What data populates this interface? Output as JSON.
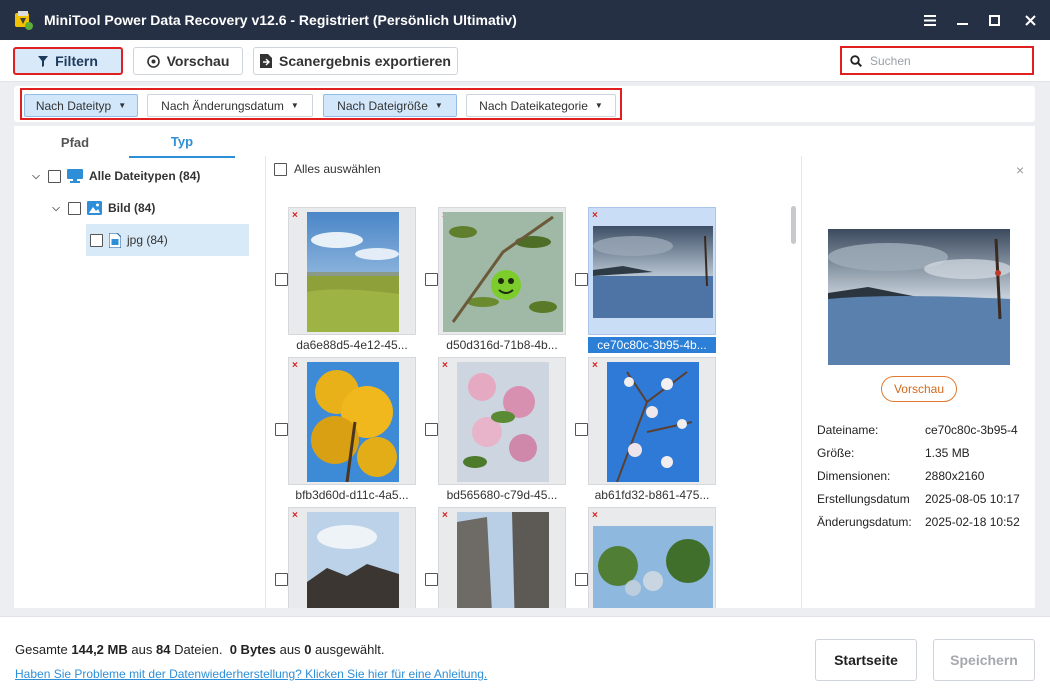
{
  "window": {
    "title": "MiniTool Power Data Recovery v12.6 - Registriert (Persönlich Ultimativ)",
    "controls": [
      "menu-icon",
      "minimize-icon",
      "maximize-icon",
      "close-icon"
    ]
  },
  "toolbar": {
    "filter_label": "Filtern",
    "preview_label": "Vorschau",
    "export_label": "Scanergebnis exportieren",
    "search_placeholder": "Suchen"
  },
  "filters": {
    "by_type": "Nach Dateityp",
    "by_modified": "Nach Änderungsdatum",
    "by_size": "Nach Dateigröße",
    "by_category": "Nach Dateikategorie"
  },
  "tabs": [
    {
      "label": "Pfad",
      "active": false
    },
    {
      "label": "Typ",
      "active": true
    }
  ],
  "tree": {
    "all_types": "Alle Dateitypen (84)",
    "image": "Bild (84)",
    "jpg": "jpg (84)"
  },
  "grid": {
    "select_all": "Alles auswählen",
    "files": [
      {
        "name": "da6e88d5-4e12-45...",
        "selected": false
      },
      {
        "name": "d50d316d-71b8-4b...",
        "selected": false
      },
      {
        "name": "ce70c80c-3b95-4b...",
        "selected": true
      },
      {
        "name": "bfb3d60d-d11c-4a5...",
        "selected": false
      },
      {
        "name": "bd565680-c79d-45...",
        "selected": false
      },
      {
        "name": "ab61fd32-b861-475...",
        "selected": false
      },
      {
        "name": "",
        "selected": false
      },
      {
        "name": "",
        "selected": false
      },
      {
        "name": "",
        "selected": false
      }
    ],
    "deleted_mark": "×"
  },
  "preview": {
    "button": "Vorschau",
    "close": "×",
    "info": [
      {
        "key": "Dateiname:",
        "value": "ce70c80c-3b95-4"
      },
      {
        "key": "Größe:",
        "value": "1.35 MB"
      },
      {
        "key": "Dimensionen:",
        "value": "2880x2160"
      },
      {
        "key": "Erstellungsdatum",
        "value": "2025-08-05 10:17"
      },
      {
        "key": "Änderungsdatum:",
        "value": "2025-02-18 10:52"
      }
    ]
  },
  "footer": {
    "summary_prefix": "Gesamte",
    "total_size": "144,2 MB",
    "summary_mid": "aus",
    "total_files": "84",
    "summary_files": "Dateien.",
    "selected_size": "0 Bytes",
    "summary_mid2": "aus",
    "selected_files": "0",
    "summary_suffix": "ausgewählt.",
    "help_link": "Haben Sie Probleme mit der Datenwiederherstellung? Klicken Sie hier für eine Anleitung.",
    "home_label": "Startseite",
    "save_label": "Speichern"
  },
  "colors": {
    "titlebar": "#263044",
    "accent": "#2e8fd8",
    "highlight_border": "#e02020",
    "selection": "#2c7fd6",
    "preview_button": "#e07a2e"
  }
}
